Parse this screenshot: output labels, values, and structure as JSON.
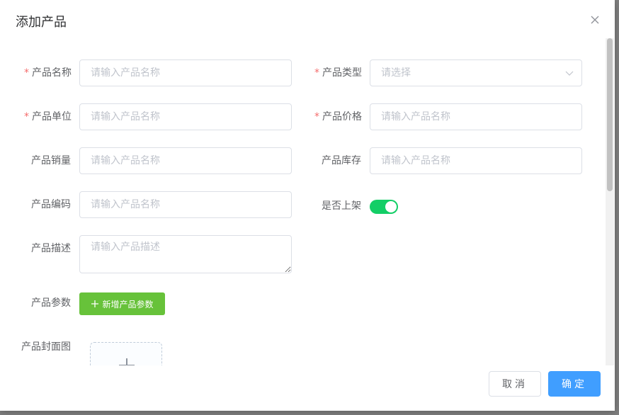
{
  "dialog": {
    "title": "添加产品"
  },
  "form": {
    "name": {
      "label": "产品名称",
      "required": "*",
      "placeholder": "请输入产品名称",
      "value": ""
    },
    "type": {
      "label": "产品类型",
      "required": "*",
      "placeholder": "请选择",
      "value": ""
    },
    "unit": {
      "label": "产品单位",
      "required": "*",
      "placeholder": "请输入产品名称",
      "value": ""
    },
    "price": {
      "label": "产品价格",
      "required": "*",
      "placeholder": "请输入产品名称",
      "value": ""
    },
    "sales": {
      "label": "产品销量",
      "placeholder": "请输入产品名称",
      "value": ""
    },
    "stock": {
      "label": "产品库存",
      "placeholder": "请输入产品名称",
      "value": ""
    },
    "code": {
      "label": "产品编码",
      "placeholder": "请输入产品名称",
      "value": ""
    },
    "on_shelf": {
      "label": "是否上架",
      "checked": true,
      "color": "#13ce66"
    },
    "desc": {
      "label": "产品描述",
      "placeholder": "请输入产品描述",
      "value": ""
    },
    "params": {
      "label": "产品参数",
      "add_button": "新增产品参数",
      "button_icon": "plus-icon"
    },
    "cover": {
      "label": "产品封面图",
      "upload_icon": "plus-icon"
    }
  },
  "footer": {
    "cancel_label": "取消",
    "confirm_label": "确定"
  },
  "colors": {
    "primary": "#409eff",
    "success": "#67c23a",
    "required": "#f56c6c",
    "switch_on": "#13ce66"
  }
}
